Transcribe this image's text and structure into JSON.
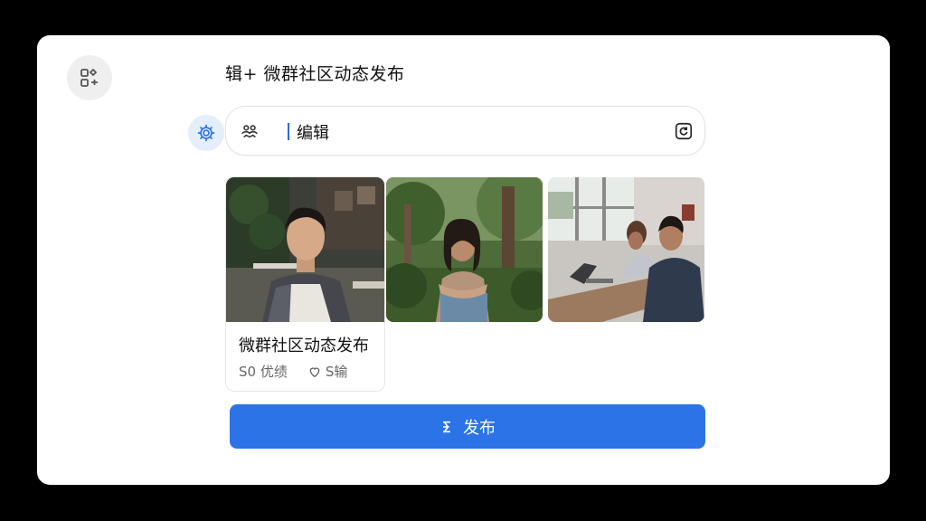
{
  "header": {
    "title": "辑+ 微群社区动态发布",
    "app_icon": "apps-icon"
  },
  "composer": {
    "settings_icon": "gear-icon",
    "lead_icon": "group-icon",
    "value": "编辑",
    "trail_icon": "refresh-icon"
  },
  "post": {
    "title": "微群社区动态发布",
    "stat_text": "S0 优绩",
    "likes": "S输"
  },
  "publish": {
    "label": "发布",
    "icon": "publish-icon"
  },
  "colors": {
    "accent": "#2b73e6",
    "settings_bg": "#e5eefc"
  }
}
